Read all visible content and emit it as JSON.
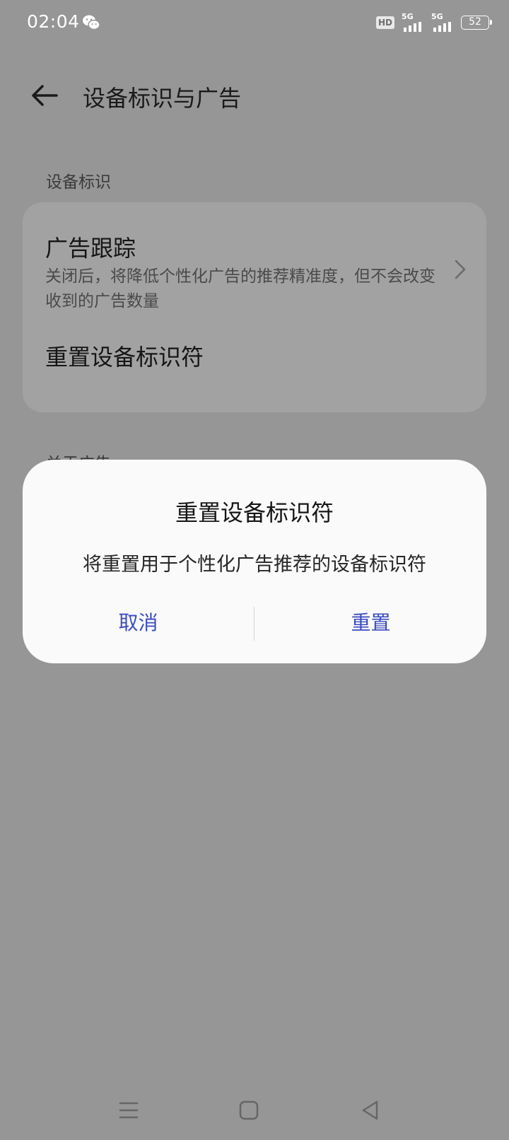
{
  "status_bar": {
    "time": "02:04",
    "hd_label": "HD",
    "sim1_network": "5G",
    "sim2_network": "5G",
    "battery_level": "52",
    "icons": [
      "wechat-icon",
      "hd-voice-icon",
      "signal-icon",
      "signal-icon",
      "battery-icon"
    ]
  },
  "header": {
    "title": "设备标识与广告",
    "back_icon": "back-arrow-icon"
  },
  "sections": {
    "device_id": {
      "label": "设备标识",
      "items": [
        {
          "title": "广告跟踪",
          "subtitle": "关闭后，将降低个性化广告的推荐精准度，但不会改变收到的广告数量",
          "icon": "chevron-right-icon"
        },
        {
          "title": "重置设备标识符"
        }
      ]
    },
    "about_ads": {
      "label": "关于广告"
    }
  },
  "dialog": {
    "title": "重置设备标识符",
    "message": "将重置用于个性化广告推荐的设备标识符",
    "cancel_label": "取消",
    "confirm_label": "重置",
    "accent_color": "#3a4bc0"
  },
  "nav_bar": {
    "icons": [
      "menu-icon",
      "home-icon",
      "back-triangle-icon"
    ]
  },
  "colors": {
    "scrim": "#969696",
    "dialog_bg": "#fafafa",
    "card_bg": "#a2a2a2"
  }
}
